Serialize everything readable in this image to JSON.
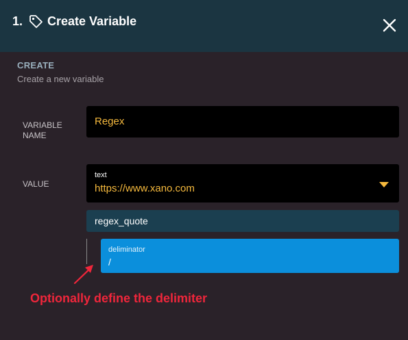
{
  "header": {
    "step": "1.",
    "title": "Create Variable",
    "icons": {
      "tag": "tag-icon",
      "close": "close-icon"
    }
  },
  "section": {
    "heading": "CREATE",
    "subtitle": "Create a new variable"
  },
  "form": {
    "variable_name_label": "VARIABLE NAME",
    "variable_name_value": "Regex",
    "value_label": "VALUE",
    "value_type": "text",
    "value_text": "https://www.xano.com",
    "filter_name": "regex_quote",
    "argument_label": "deliminator",
    "argument_value": "/"
  },
  "annotation": {
    "text": "Optionally define the delimiter"
  },
  "colors": {
    "header_bg": "#1b3541",
    "panel_bg": "#2a2229",
    "input_bg": "#000000",
    "value_text": "#f5b93d",
    "filter_bg": "#1b3f50",
    "argument_bg": "#0b8fdc",
    "annotation": "#f0263b"
  }
}
